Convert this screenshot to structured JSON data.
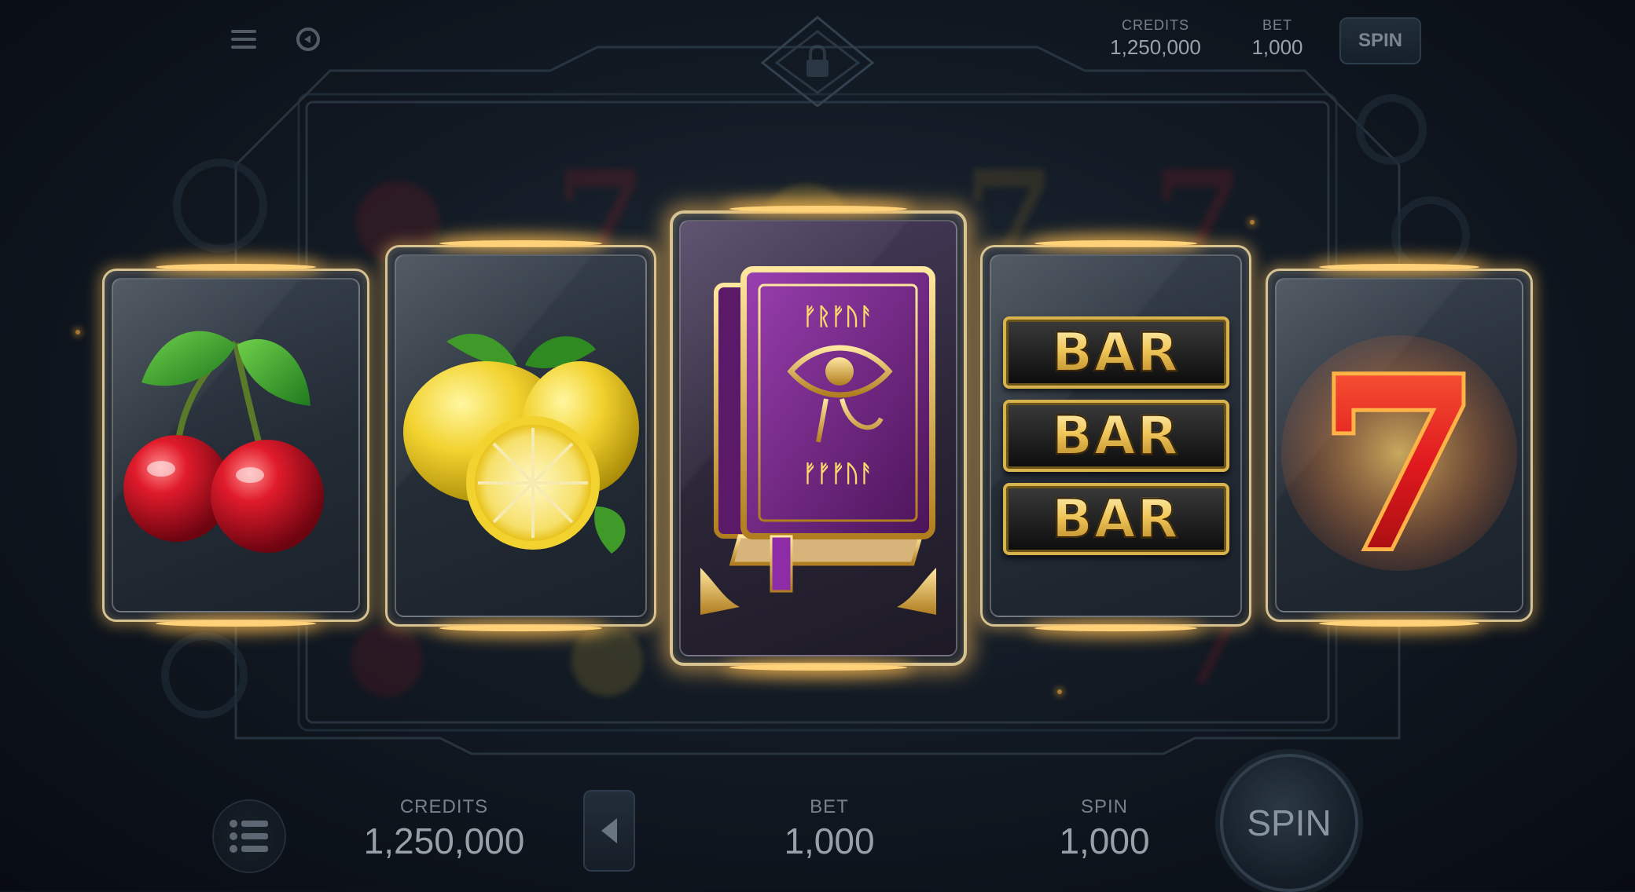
{
  "top_hud": {
    "credits_label": "CREDITS",
    "credits_value": "1,250,000",
    "bet_label": "BET",
    "bet_value": "1,000",
    "spin_label": "SPIN",
    "menu_icon": "hamburger-icon",
    "refresh_icon": "refresh-icon",
    "lock_icon": "lock-icon"
  },
  "reels": [
    {
      "symbol": "cherry",
      "icon": "cherry-icon"
    },
    {
      "symbol": "lemon",
      "icon": "lemon-icon"
    },
    {
      "symbol": "book",
      "icon": "book-of-runes-icon",
      "runes_top": "ᚠᚱᚠᚢᚨ",
      "runes_bottom": "ᚠᚠᚠᚢᚨ"
    },
    {
      "symbol": "bar",
      "icon": "triple-bar-icon",
      "bars": [
        "BAR",
        "BAR",
        "BAR"
      ]
    },
    {
      "symbol": "seven",
      "icon": "flaming-seven-icon",
      "text": "7"
    }
  ],
  "bottom_hud": {
    "credits_label": "CREDITS",
    "credits_value": "1,250,000",
    "bet_label": "BET",
    "bet_value": "1,000",
    "spin_label": "SPIN",
    "spin_value": "1,000",
    "spin_button": "SPIN",
    "menu_icon": "list-icon",
    "arrow_icon": "arrow-left-icon"
  },
  "colors": {
    "gold": "#d8b34d",
    "glow": "#ffd27a",
    "purple": "#7d2c8c",
    "cherry": "#c8102e",
    "lemon": "#f2d22e"
  }
}
